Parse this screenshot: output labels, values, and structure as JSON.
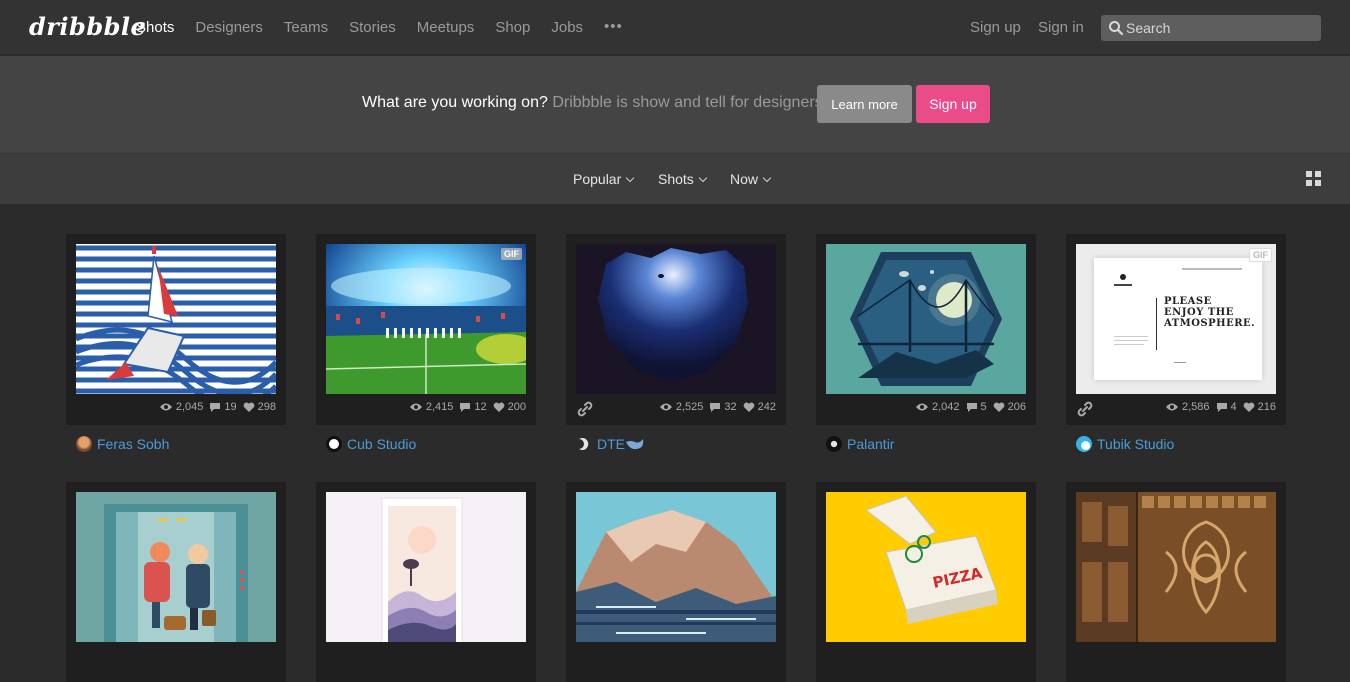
{
  "nav": {
    "logo": "dribbble",
    "links": [
      "Shots",
      "Designers",
      "Teams",
      "Stories",
      "Meetups",
      "Shop",
      "Jobs"
    ],
    "more": "•••",
    "sign_up": "Sign up",
    "sign_in": "Sign in",
    "search_placeholder": "Search"
  },
  "banner": {
    "question": "What are you working on?",
    "description": " Dribbble is show and tell for designers.",
    "learn_more": "Learn more",
    "sign_up": "Sign up"
  },
  "filters": {
    "sort": "Popular",
    "type": "Shots",
    "time": "Now"
  },
  "shots": [
    {
      "views": "2,045",
      "comments": "19",
      "likes": "298",
      "author": "Feras Sobh",
      "gif": "",
      "attachment": false
    },
    {
      "views": "2,415",
      "comments": "12",
      "likes": "200",
      "author": "Cub Studio",
      "gif": "GIF",
      "attachment": false
    },
    {
      "views": "2,525",
      "comments": "32",
      "likes": "242",
      "author": "DTE",
      "gif": "",
      "attachment": true
    },
    {
      "views": "2,042",
      "comments": "5",
      "likes": "206",
      "author": "Palantir",
      "gif": "",
      "attachment": false
    },
    {
      "views": "2,586",
      "comments": "4",
      "likes": "216",
      "author": "Tubik Studio",
      "gif": "GIF",
      "attachment": true
    }
  ],
  "shot_text": {
    "tubik_headline": "PLEASE ENJOY THE ATMOSPHERE.",
    "pizza_label": "PIZZA"
  },
  "colors": {
    "accent_pink": "#ea4c89",
    "link_blue": "#4a9bd9",
    "nav_bg": "#333333",
    "banner_bg": "#444444"
  }
}
